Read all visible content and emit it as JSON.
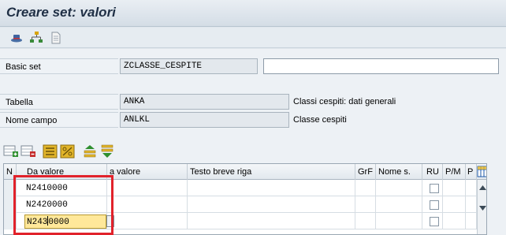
{
  "window": {
    "title": "Creare set: valori"
  },
  "toolbar": {
    "icons": [
      "hat-icon",
      "hierarchy-icon",
      "document-icon"
    ]
  },
  "form": {
    "basic_set_label": "Basic set",
    "basic_set_value": "ZCLASSE_CESPITE",
    "basic_set_desc": "",
    "tabella_label": "Tabella",
    "tabella_value": "ANKA",
    "tabella_desc": "Classi cespiti: dati generali",
    "nome_campo_label": "Nome campo",
    "nome_campo_value": "ANLKL",
    "nome_campo_desc": "Classe cespiti"
  },
  "table": {
    "headers": {
      "n": "N",
      "da_valore": "Da valore",
      "a_valore": "a valore",
      "testo": "Testo breve riga",
      "grf": "GrF",
      "nome_s": "Nome s.",
      "ru": "RU",
      "pm": "P/M",
      "p": "P"
    },
    "rows": [
      {
        "da": "N2410000",
        "a": "",
        "testo": "",
        "ru": false
      },
      {
        "da": "N2420000",
        "a": "",
        "testo": "",
        "ru": false
      },
      {
        "da_before_caret": "N243",
        "da_after_caret": "0000",
        "a": "",
        "testo": "",
        "ru": false
      }
    ]
  },
  "colors": {
    "highlight": "#e1222b",
    "active_cell": "#ffe89a"
  }
}
